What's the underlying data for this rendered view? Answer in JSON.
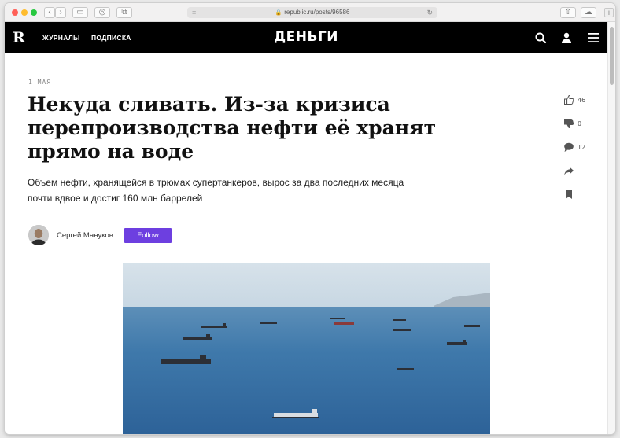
{
  "browser": {
    "url": "republic.ru/posts/96586"
  },
  "nav": {
    "logo": "R",
    "links": [
      "ЖУРНАЛЫ",
      "ПОДПИСКА"
    ],
    "brand": "ДЕНЬГИ"
  },
  "article": {
    "date": "1 МАЯ",
    "title_bold": "Некуда сливать.",
    "title_rest": " Из-за кризиса перепроизводства нефти её хранят прямо на воде",
    "lead": "Объем нефти, хранящейся в трюмах супертанкеров, вырос за два последних месяца почти вдвое и достиг 160 млн баррелей",
    "author": "Сергей Мануков",
    "follow_label": "Follow"
  },
  "sidebar": {
    "likes": "46",
    "dislikes": "0",
    "comments": "12"
  },
  "colors": {
    "accent": "#6d3fe0",
    "header": "#000000"
  }
}
